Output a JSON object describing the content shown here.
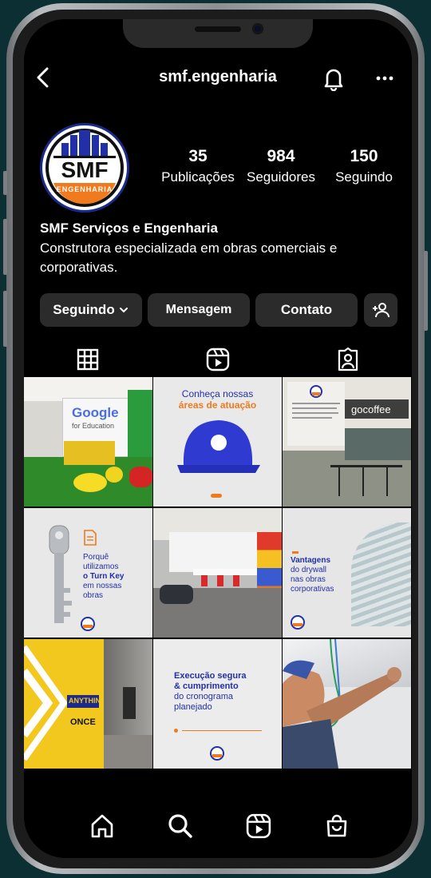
{
  "profile": {
    "username": "smf.engenharia",
    "display_name": "SMF Serviços e Engenharia",
    "bio_line1": "Construtora especializada em obras comerciais e",
    "bio_line2": "corporativas.",
    "logo_text": "SMF",
    "logo_subtext": "ENGENHARIA"
  },
  "stats": {
    "posts_count": "35",
    "posts_label": "Publicações",
    "followers_count": "984",
    "followers_label": "Seguidores",
    "following_count": "150",
    "following_label": "Seguindo"
  },
  "actions": {
    "following": "Seguindo",
    "message": "Mensagem",
    "contact": "Contato"
  },
  "posts": {
    "p1_brand": "Google",
    "p1_sub": "for Education",
    "p2_line1": "Conheça nossas",
    "p2_line2": "áreas de atuação",
    "p3_sign": "gocoffee",
    "p4_line1": "Porquê",
    "p4_line2": "utilizamos",
    "p4_line3": "o Turn Key",
    "p4_line4": "em nossas",
    "p4_line5": "obras",
    "p6_line1": "Vantagens",
    "p6_line2": "do drywall",
    "p6_line3": "nas obras",
    "p6_line4": "corporativas",
    "p7_sign1": "ANYTHING",
    "p7_sign2": "ONCE",
    "p8_line1": "Execução segura",
    "p8_line2": "& cumprimento",
    "p8_line3": "do cronograma",
    "p8_line4": "planejado"
  },
  "colors": {
    "brand_blue": "#2230a8",
    "brand_orange": "#f07a1e",
    "button_bg": "#2b2b2b"
  },
  "icons": [
    "back-icon",
    "bell-icon",
    "more-icon",
    "chevron-down-icon",
    "add-person-icon",
    "grid-icon",
    "reels-icon",
    "tagged-icon",
    "home-icon",
    "search-icon",
    "shop-icon"
  ]
}
